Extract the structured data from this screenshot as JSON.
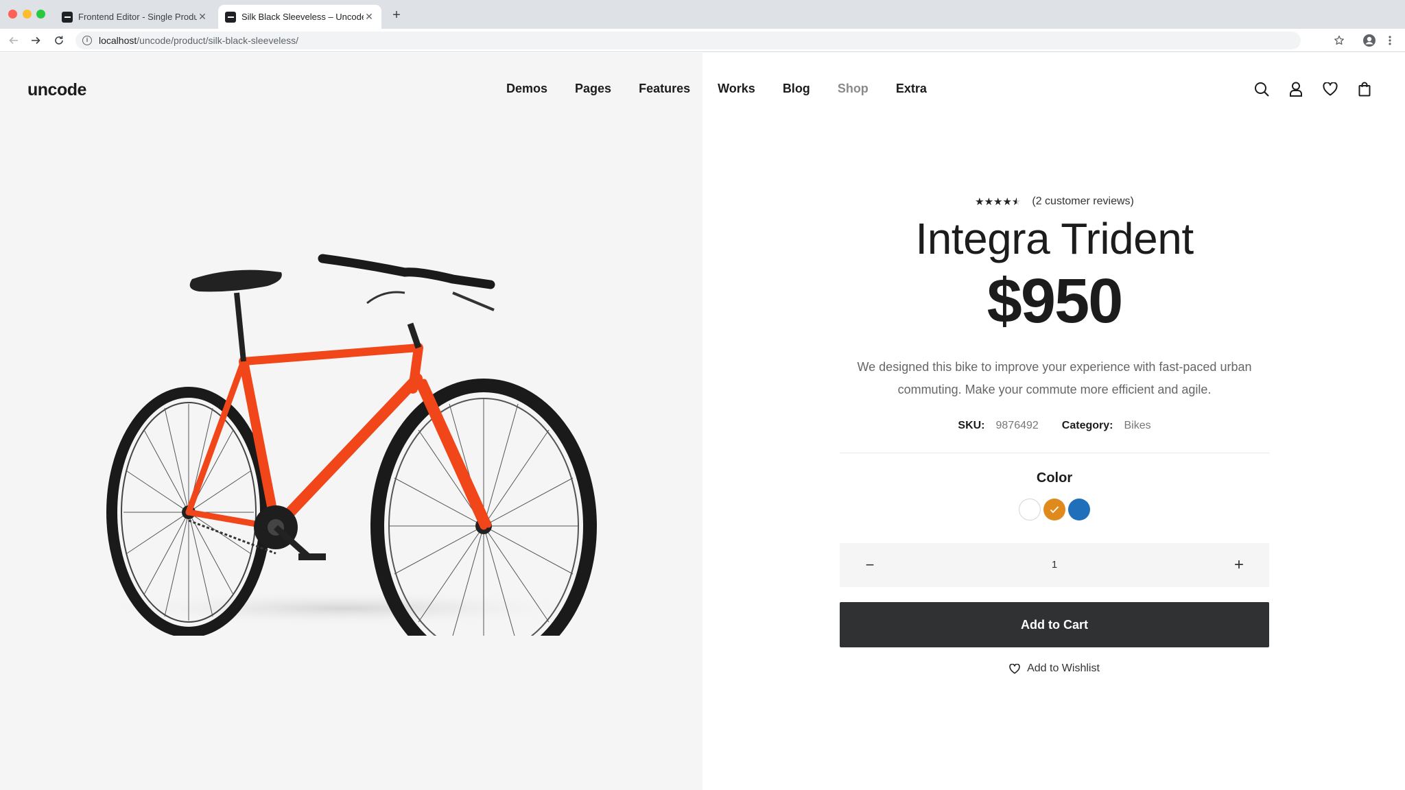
{
  "browser": {
    "tabs": [
      {
        "title": "Frontend Editor - Single Produ",
        "active": false
      },
      {
        "title": "Silk Black Sleeveless – Uncode",
        "active": true
      }
    ],
    "url_host": "localhost",
    "url_path": "/uncode/product/silk-black-sleeveless/",
    "icons": {
      "back": "arrow-left-icon",
      "forward": "arrow-right-icon",
      "reload": "reload-icon",
      "info": "info-icon",
      "bookmark": "star-icon",
      "profile": "profile-icon",
      "menu": "kebab-icon"
    }
  },
  "header": {
    "logo": "uncode",
    "nav": [
      "Demos",
      "Pages",
      "Features",
      "Works",
      "Blog",
      "Shop",
      "Extra"
    ],
    "active_nav": "Shop",
    "icons": [
      "search-icon",
      "user-icon",
      "heart-icon",
      "bag-icon"
    ]
  },
  "product": {
    "image": "orange-bicycle",
    "rating": 4.5,
    "rating_max": 5,
    "stars": "★★★★★",
    "reviews": "(2 customer reviews)",
    "title": "Integra Trident",
    "price": "$950",
    "description": "We designed this bike to improve your experience with fast-paced urban commuting. Make your commute more efficient and agile.",
    "sku_label": "SKU:",
    "sku": "9876492",
    "category_label": "Category:",
    "category": "Bikes",
    "color_label": "Color",
    "swatches": [
      {
        "name": "white",
        "color": "#ffffff",
        "selected": false
      },
      {
        "name": "orange",
        "color": "#e08a1e",
        "selected": true
      },
      {
        "name": "blue",
        "color": "#1f6fba",
        "selected": false
      }
    ],
    "qty_minus": "−",
    "qty": "1",
    "qty_plus": "+",
    "add_to_cart": "Add to Cart",
    "wishlist": "Add to Wishlist"
  },
  "colors": {
    "frame": "#f0461a",
    "button": "#303133",
    "muted": "#8a8a8a"
  }
}
